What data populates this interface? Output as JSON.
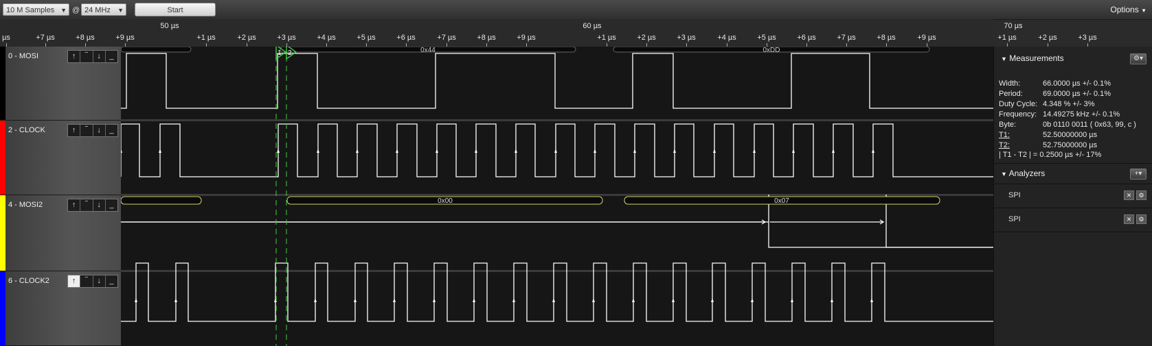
{
  "toolbar": {
    "samples": "10 M Samples",
    "at": "@",
    "rate": "24 MHz",
    "start": "Start",
    "options": "Options"
  },
  "ruler": {
    "major": [
      "50 µs",
      "60 µs",
      "70 µs"
    ],
    "labels": [
      "µs",
      "+7 µs",
      "+8 µs",
      "+9 µs",
      "+1 µs",
      "+2 µs",
      "+3 µs",
      "+4 µs",
      "+5 µs",
      "+6 µs",
      "+7 µs",
      "+8 µs",
      "+9 µs",
      "+1 µs",
      "+2 µs",
      "+3 µs",
      "+4 µs",
      "+5 µs",
      "+6 µs",
      "+7 µs",
      "+8 µs",
      "+9 µs",
      "+1 µs",
      "+2 µs",
      "+3 µs"
    ]
  },
  "channels": [
    {
      "name": "0 - MOSI",
      "color": "#000000"
    },
    {
      "name": "2 - CLOCK",
      "color": "#ff0000"
    },
    {
      "name": "4 - MOSI2",
      "color": "#ffff00"
    },
    {
      "name": "6 - CLOCK2",
      "color": "#0000ff"
    }
  ],
  "trigger_icons": [
    "rising-edge-icon",
    "high-level-icon",
    "falling-edge-icon",
    "low-level-icon"
  ],
  "decode": {
    "mosi": [
      "0x44",
      "0xDD"
    ],
    "mosi2": [
      "0x00",
      "0x07"
    ]
  },
  "markers": [
    "1",
    "2"
  ],
  "measurements": {
    "title": "Measurements",
    "rows": [
      {
        "k": "Width:",
        "v": "66.0000 µs +/- 0.1%",
        "u": false
      },
      {
        "k": "Period:",
        "v": "69.0000 µs +/- 0.1%",
        "u": false
      },
      {
        "k": "Duty Cycle:",
        "v": "4.348 % +/- 3%",
        "u": false
      },
      {
        "k": "Frequency:",
        "v": "14.49275 kHz +/- 0.1%",
        "u": false
      },
      {
        "k": "Byte:",
        "v": "0b  0110  0011  ( 0x63, 99, c )",
        "u": false
      },
      {
        "k": "T1:",
        "v": "52.50000000 µs",
        "u": true
      },
      {
        "k": "T2:",
        "v": "52.75000000 µs",
        "u": true
      }
    ],
    "delta": "| T1 - T2 | = 0.2500 µs +/- 17%"
  },
  "analyzers": {
    "title": "Analyzers",
    "items": [
      "SPI",
      "SPI"
    ]
  },
  "colors": {
    "accent": "#e6e65a",
    "marker": "#44dd44",
    "trace": "#ffffff"
  }
}
